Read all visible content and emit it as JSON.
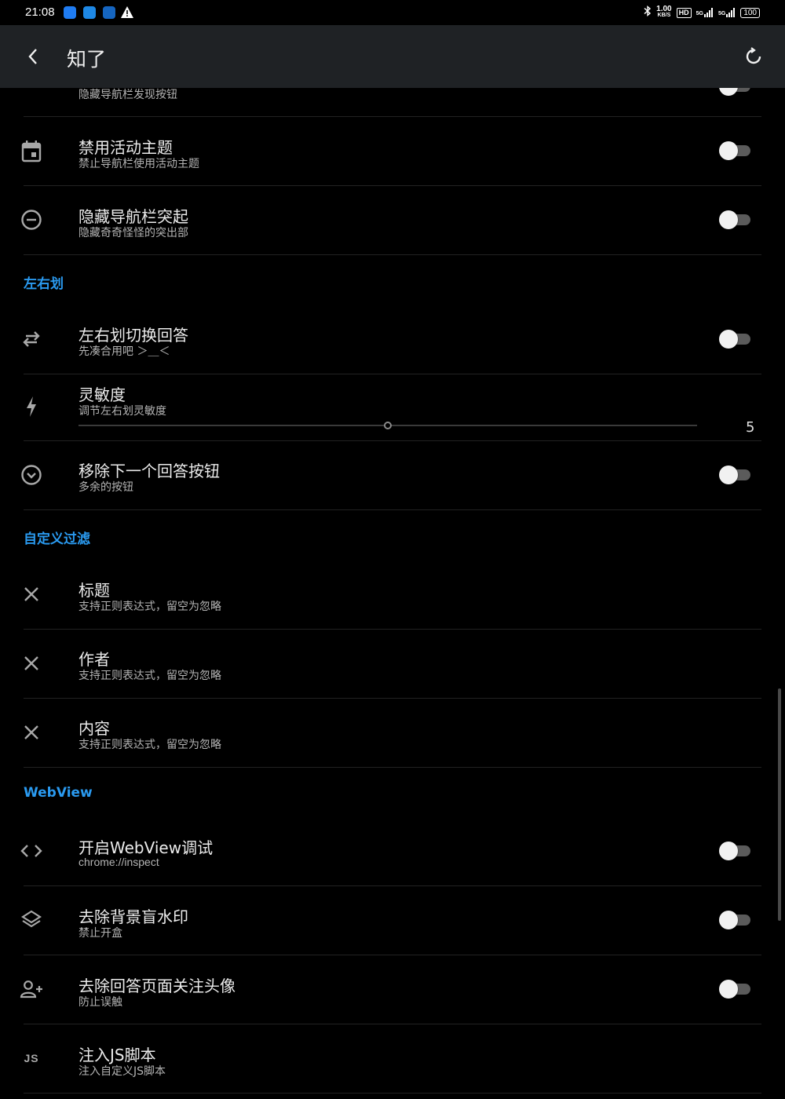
{
  "status_bar": {
    "time": "21:08",
    "speed_value": "1.00",
    "speed_unit": "KB/S",
    "hd": "HD",
    "sig1": "5G",
    "sig2": "5G",
    "battery": "100",
    "app_icon_colors": [
      "#1f7cf2",
      "#1e88e5",
      "#1565c0"
    ]
  },
  "topbar": {
    "title": "知了"
  },
  "items": {
    "hide_discover": {
      "subtitle": "隐藏导航栏发现按钮",
      "enabled": false
    },
    "disable_activity_theme": {
      "title": "禁用活动主题",
      "subtitle": "禁止导航栏使用活动主题",
      "enabled": false
    },
    "hide_navbar_bulge": {
      "title": "隐藏导航栏突起",
      "subtitle": "隐藏奇奇怪怪的突出部",
      "enabled": false
    },
    "swipe_switch_answer": {
      "title": "左右划切换回答",
      "subtitle": "先凑合用吧 ＞＿＜",
      "enabled": false
    },
    "sensitivity": {
      "title": "灵敏度",
      "subtitle": "调节左右划灵敏度",
      "value": "5",
      "fraction": 0.5
    },
    "remove_next_answer": {
      "title": "移除下一个回答按钮",
      "subtitle": "多余的按钮",
      "enabled": false
    },
    "filter_title": {
      "title": "标题",
      "subtitle": "支持正则表达式，留空为忽略"
    },
    "filter_author": {
      "title": "作者",
      "subtitle": "支持正则表达式，留空为忽略"
    },
    "filter_content": {
      "title": "内容",
      "subtitle": "支持正则表达式，留空为忽略"
    },
    "webview_debug": {
      "title": "开启WebView调试",
      "subtitle": "chrome://inspect",
      "enabled": false
    },
    "remove_watermark": {
      "title": "去除背景盲水印",
      "subtitle": "禁止开盒",
      "enabled": false
    },
    "remove_follow_avatar": {
      "title": "去除回答页面关注头像",
      "subtitle": "防止误触",
      "enabled": false
    },
    "inject_js": {
      "title": "注入JS脚本",
      "subtitle": "注入自定义JS脚本",
      "icon_text": "JS"
    }
  },
  "sections": {
    "swipe": "左右划",
    "custom_filter": "自定义过滤",
    "webview": "WebView"
  },
  "colors": {
    "accent": "#2a9af0",
    "topbar_bg": "#1f2225",
    "background": "#000000"
  }
}
